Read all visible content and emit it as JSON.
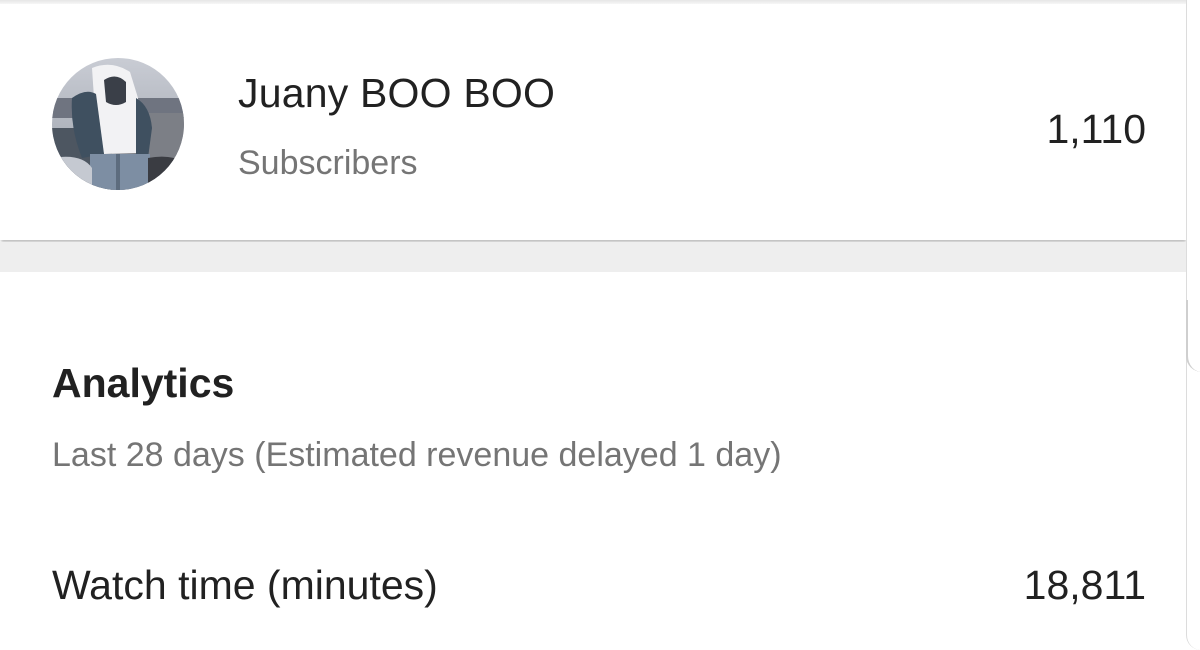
{
  "channel": {
    "name": "Juany BOO BOO",
    "subscribers_label": "Subscribers",
    "subscribers_count": "1,110",
    "avatar_icon": "channel-avatar-photo"
  },
  "analytics": {
    "title": "Analytics",
    "subtitle": "Last 28 days (Estimated revenue delayed 1 day)",
    "metrics": [
      {
        "label": "Watch time (minutes)",
        "value": "18,811"
      }
    ]
  },
  "colors": {
    "primary_text": "#212121",
    "secondary_text": "#757575",
    "separator": "#eeeeee"
  }
}
